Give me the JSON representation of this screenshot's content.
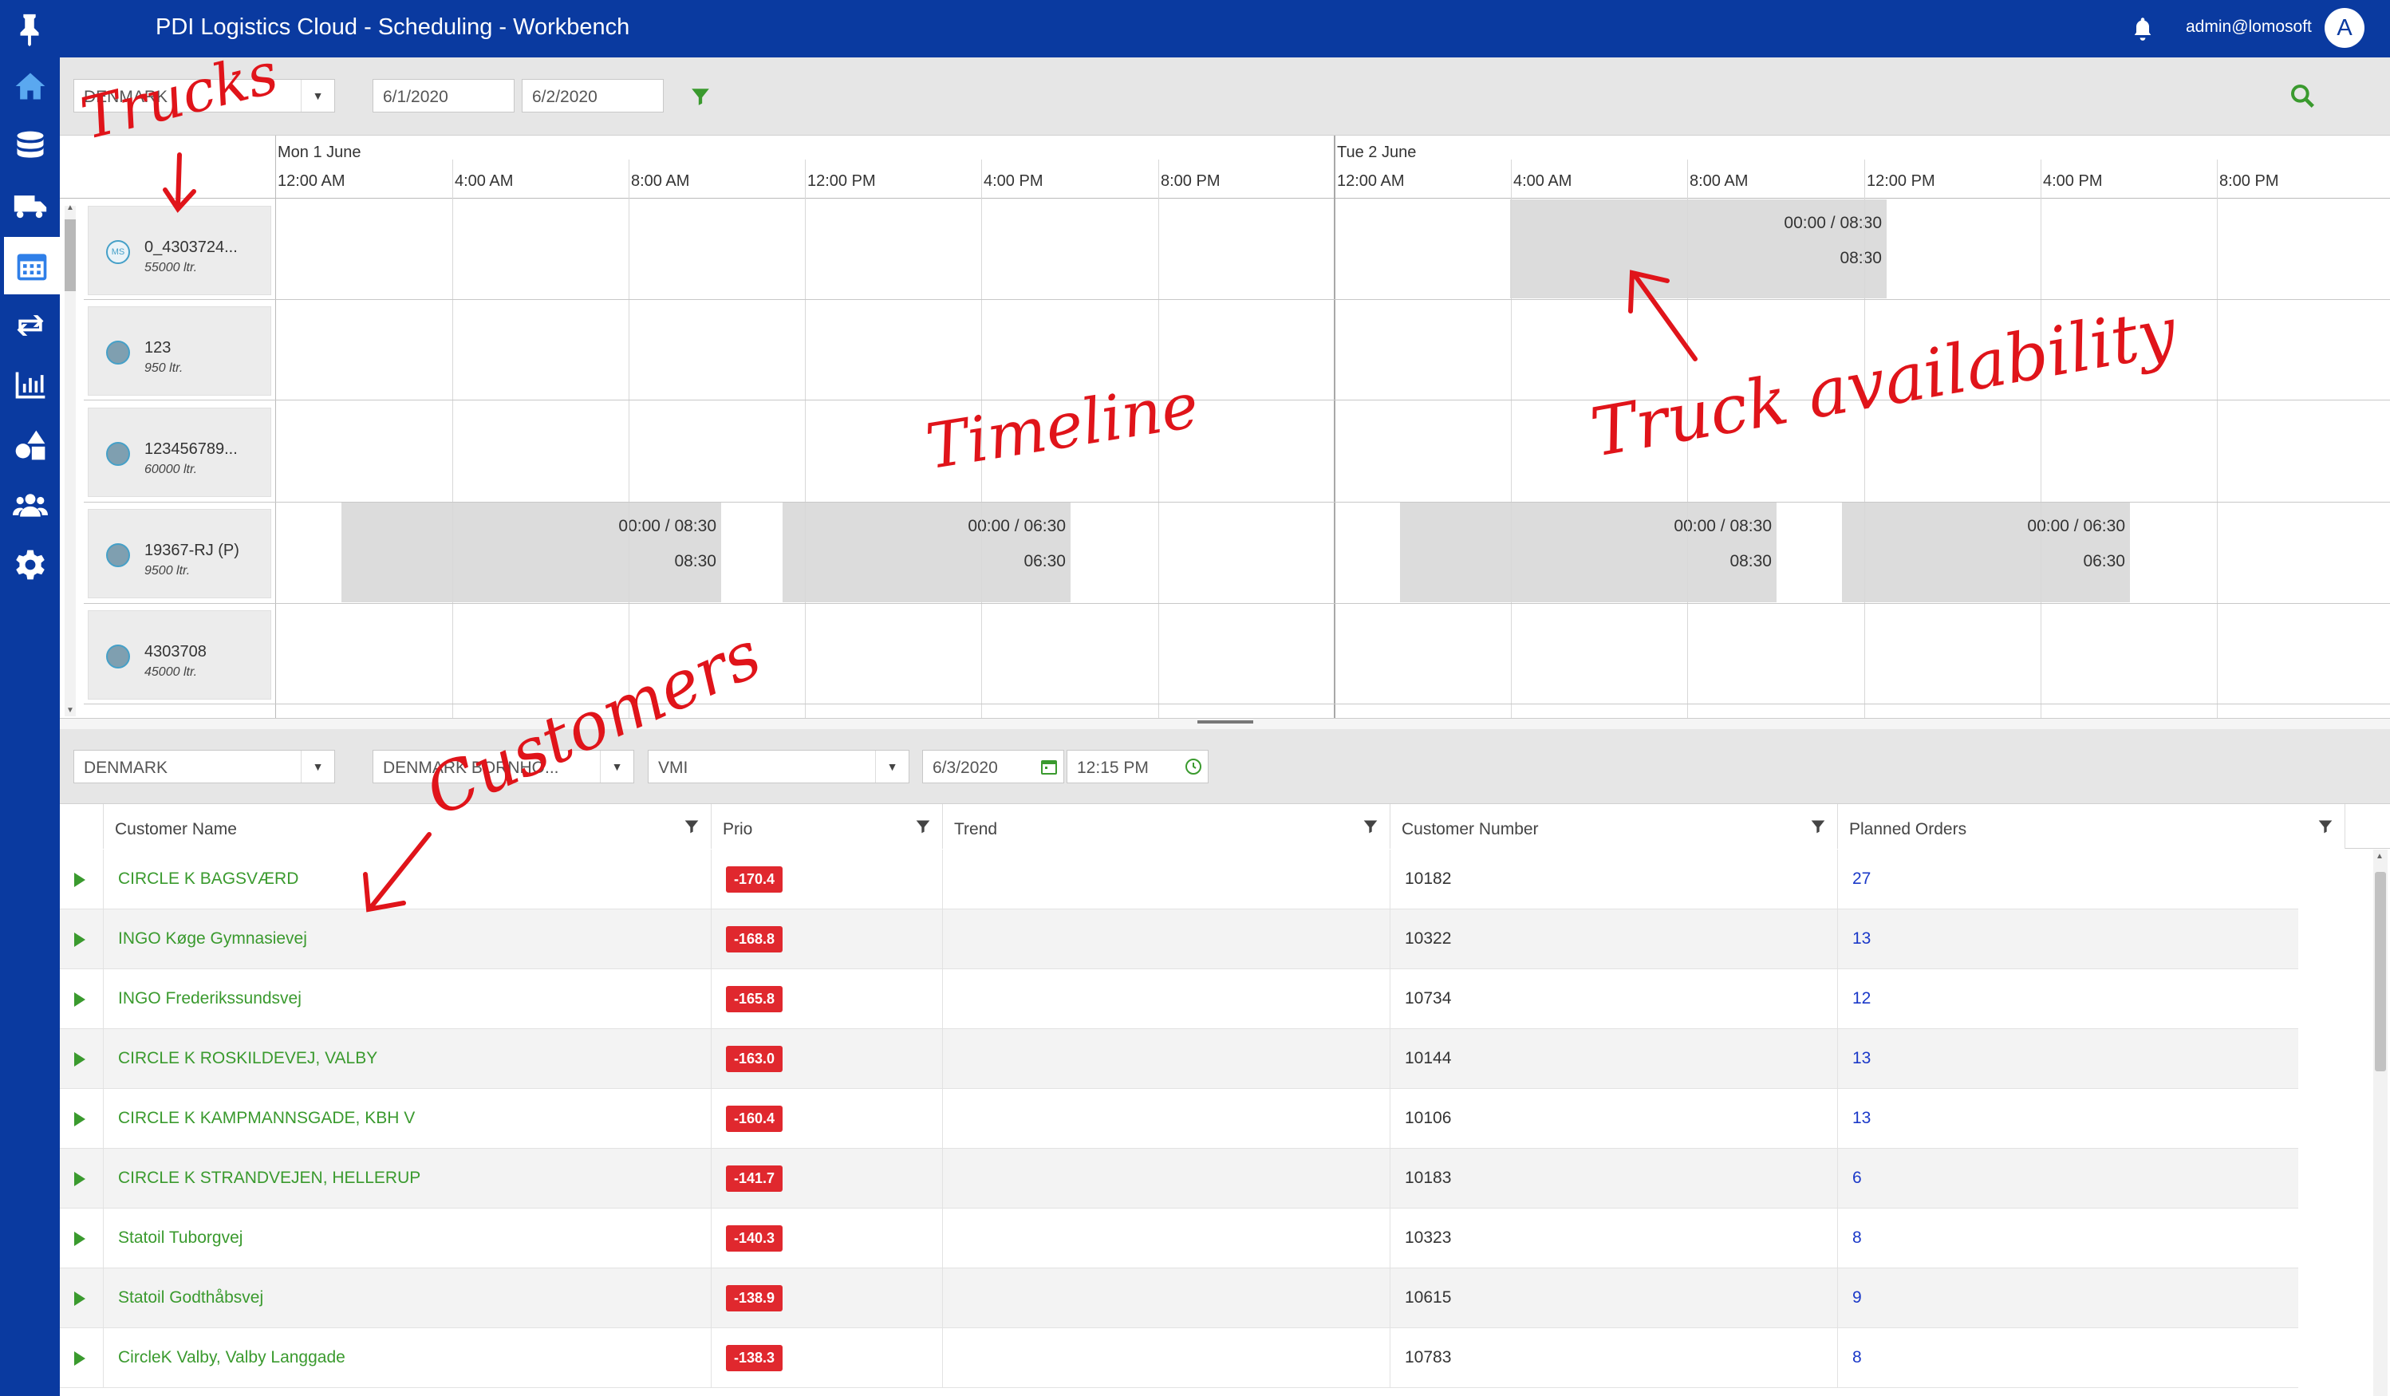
{
  "header": {
    "title": "PDI Logistics Cloud - Scheduling - Workbench",
    "user": "admin@lomosoft",
    "avatar_letter": "A"
  },
  "nav": {
    "items": [
      "home-icon",
      "database-icon",
      "truck-icon",
      "calendar-icon",
      "transfer-icon",
      "bar-chart-icon",
      "shapes-icon",
      "users-icon",
      "gear-icon"
    ],
    "active": "calendar-icon"
  },
  "timeline_toolbar": {
    "country": "DENMARK",
    "date_from": "6/1/2020",
    "date_to": "6/2/2020"
  },
  "timeline": {
    "days": [
      {
        "label": "Mon 1 June",
        "hours": [
          "12:00 AM",
          "4:00 AM",
          "8:00 AM",
          "12:00 PM",
          "4:00 PM",
          "8:00 PM"
        ]
      },
      {
        "label": "Tue 2 June",
        "hours": [
          "12:00 AM",
          "4:00 AM",
          "8:00 AM",
          "12:00 PM",
          "4:00 PM",
          "8:00 PM"
        ]
      }
    ],
    "trucks": [
      {
        "name": "0_4303724...",
        "capacity": "55000 ltr.",
        "badge": "MS"
      },
      {
        "name": "123",
        "capacity": "950 ltr.",
        "badge": ""
      },
      {
        "name": "123456789...",
        "capacity": "60000 ltr.",
        "badge": ""
      },
      {
        "name": "19367-RJ (P)",
        "capacity": "9500 ltr.",
        "badge": ""
      },
      {
        "name": "4303708",
        "capacity": "45000 ltr.",
        "badge": ""
      }
    ],
    "availability": [
      {
        "line1": "00:00 / 08:30",
        "line2": "08:30"
      },
      {
        "line1": "00:00 / 08:30",
        "line2": "08:30"
      },
      {
        "line1": "00:00 / 06:30",
        "line2": "06:30"
      },
      {
        "line1": "00:00 / 08:30",
        "line2": "08:30"
      },
      {
        "line1": "00:00 / 06:30",
        "line2": "06:30"
      }
    ]
  },
  "customer_toolbar": {
    "country": "DENMARK",
    "region": "DENMARK BORNHO...",
    "type": "VMI",
    "date": "6/3/2020",
    "time": "12:15 PM"
  },
  "grid": {
    "columns": [
      "Customer Name",
      "Prio",
      "Trend",
      "Customer Number",
      "Planned Orders"
    ],
    "rows": [
      {
        "name": "CIRCLE K BAGSVÆRD",
        "prio": "-170.4",
        "trend": "",
        "number": "10182",
        "planned": "27"
      },
      {
        "name": "INGO Køge Gymnasievej",
        "prio": "-168.8",
        "trend": "",
        "number": "10322",
        "planned": "13"
      },
      {
        "name": "INGO Frederikssundsvej",
        "prio": "-165.8",
        "trend": "",
        "number": "10734",
        "planned": "12"
      },
      {
        "name": "CIRCLE K ROSKILDEVEJ, VALBY",
        "prio": "-163.0",
        "trend": "",
        "number": "10144",
        "planned": "13"
      },
      {
        "name": "CIRCLE K KAMPMANNSGADE, KBH V",
        "prio": "-160.4",
        "trend": "",
        "number": "10106",
        "planned": "13"
      },
      {
        "name": "CIRCLE K STRANDVEJEN, HELLERUP",
        "prio": "-141.7",
        "trend": "",
        "number": "10183",
        "planned": "6"
      },
      {
        "name": "Statoil Tuborgvej",
        "prio": "-140.3",
        "trend": "",
        "number": "10323",
        "planned": "8"
      },
      {
        "name": "Statoil Godthåbsvej",
        "prio": "-138.9",
        "trend": "",
        "number": "10615",
        "planned": "9"
      },
      {
        "name": "CircleK Valby, Valby Langgade",
        "prio": "-138.3",
        "trend": "",
        "number": "10783",
        "planned": "8"
      }
    ]
  },
  "annotations": {
    "trucks": "Trucks",
    "timeline": "Timeline",
    "availability": "Truck availability",
    "customers": "Customers"
  },
  "colors": {
    "brand": "#0a3aa0",
    "customer_green": "#3a9a2e",
    "prio_red": "#e0282e",
    "planned_blue": "#1a38c8",
    "annotation_red": "#e0141a"
  }
}
